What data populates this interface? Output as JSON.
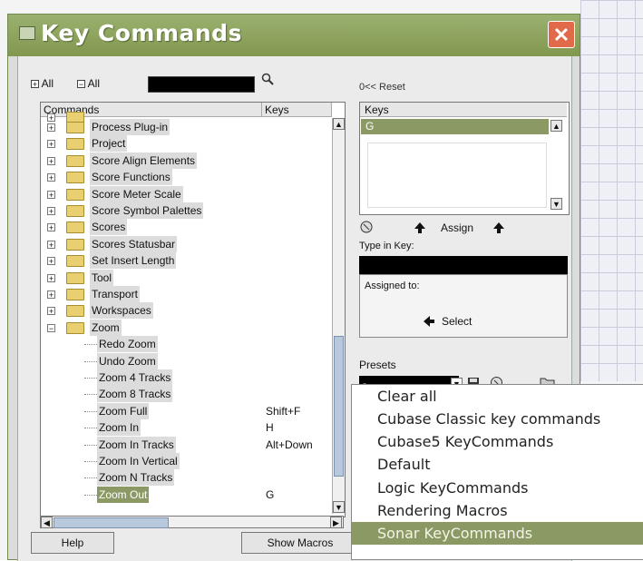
{
  "window": {
    "title": "Key Commands",
    "close_glyph": "✕"
  },
  "toolbar": {
    "expand_all": "All",
    "collapse_all": "All",
    "search_value": ""
  },
  "commands": {
    "header_commands": "Commands",
    "header_keys": "Keys",
    "folders": [
      "Process Plug-in",
      "Project",
      "Score Align Elements",
      "Score Functions",
      "Score Meter Scale",
      "Score Symbol Palettes",
      "Scores",
      "Scores Statusbar",
      "Set Insert Length",
      "Tool",
      "Transport",
      "Workspaces",
      "Zoom"
    ],
    "zoom_items": [
      {
        "name": "Redo Zoom",
        "key": ""
      },
      {
        "name": "Undo Zoom",
        "key": ""
      },
      {
        "name": "Zoom 4 Tracks",
        "key": ""
      },
      {
        "name": "Zoom 8 Tracks",
        "key": ""
      },
      {
        "name": "Zoom Full",
        "key": "Shift+F"
      },
      {
        "name": "Zoom In",
        "key": "H"
      },
      {
        "name": "Zoom In Tracks",
        "key": "Alt+Down"
      },
      {
        "name": "Zoom In Vertical",
        "key": ""
      },
      {
        "name": "Zoom N Tracks",
        "key": ""
      },
      {
        "name": "Zoom Out",
        "key": "G"
      }
    ]
  },
  "right": {
    "reset_label": "0<< Reset",
    "keys_header": "Keys",
    "keys_selected": "G",
    "assign_label": "Assign",
    "type_in_key_label": "Type in Key:",
    "type_in_key_value": "",
    "assigned_to_label": "Assigned to:",
    "select_label": "Select",
    "presets_label": "Presets",
    "presets_value": "-"
  },
  "buttons": {
    "help": "Help",
    "show_macros": "Show Macros"
  },
  "presets_dropdown": {
    "options": [
      "Clear all",
      "Cubase Classic key commands",
      "Cubase5 KeyCommands",
      "Default",
      "Logic KeyCommands",
      "Rendering Macros",
      "Sonar KeyCommands"
    ],
    "highlighted": "Sonar KeyCommands"
  },
  "colors": {
    "titlebar": "#8fa660",
    "selection": "#8b9a64",
    "close": "#e06a4a"
  }
}
